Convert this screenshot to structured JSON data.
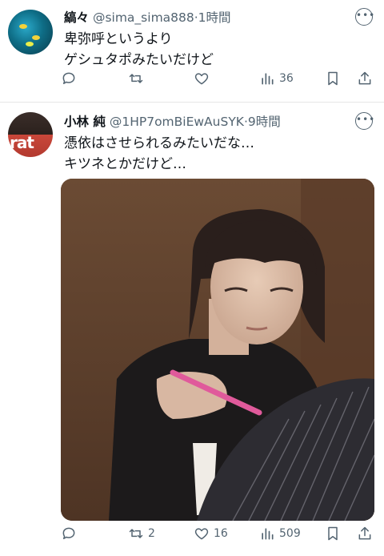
{
  "tweets": [
    {
      "name": "縞々",
      "handle": "@sima_sima888",
      "time": "·1時間",
      "lines": [
        "卑弥呼というより",
        "ゲシュタポみたいだけど"
      ],
      "stats": {
        "replies": "",
        "retweets": "",
        "likes": "",
        "views": "36"
      }
    },
    {
      "name": "小林 純",
      "handle": "@1HP7omBiEwAuSYK",
      "time": "·9時間",
      "lines": [
        "憑依はさせられるみたいだな…",
        "キツネとかだけど…"
      ],
      "stats": {
        "replies": "",
        "retweets": "2",
        "likes": "16",
        "views": "509"
      }
    }
  ],
  "icons": {
    "more": "more-icon",
    "reply": "reply-icon",
    "retweet": "retweet-icon",
    "like": "heart-icon",
    "views": "views-icon",
    "bookmark": "bookmark-icon",
    "share": "share-icon"
  },
  "colors": {
    "text": "#0f1419",
    "muted": "#536471",
    "divider": "#e6e6e6"
  }
}
